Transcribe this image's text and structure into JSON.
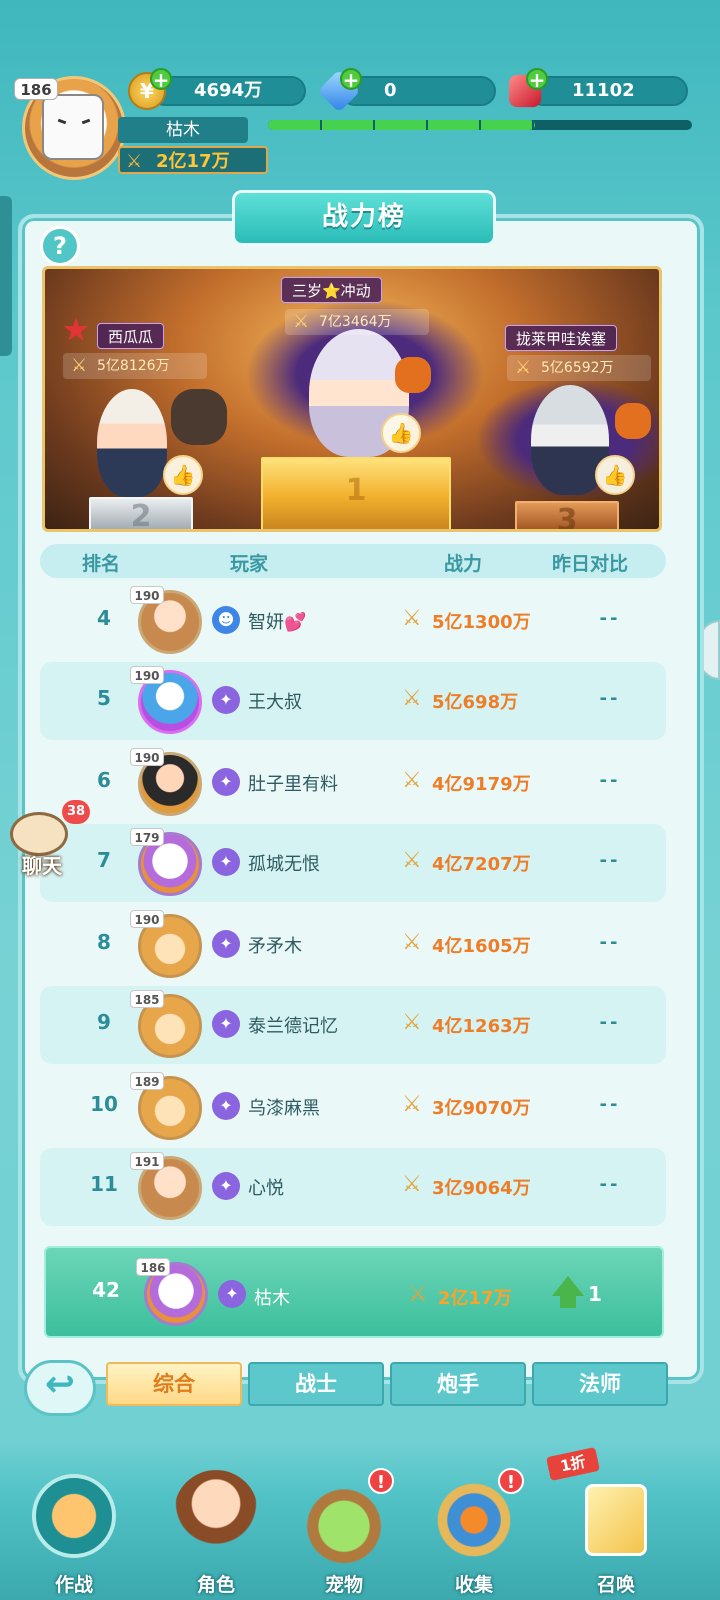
{
  "player": {
    "level": "186",
    "name": "枯木",
    "power": "2亿17万",
    "xp_fraction": 0.63
  },
  "resources": {
    "gold": "4694万",
    "diamond": "0",
    "ruby": "11102"
  },
  "board": {
    "title": "战力榜",
    "help_glyph": "?"
  },
  "podium": {
    "first": {
      "name": "三岁⭐冲动",
      "power": "7亿3464万",
      "place": "1"
    },
    "second": {
      "name": "西瓜瓜",
      "power": "5亿8126万",
      "place": "2"
    },
    "third": {
      "name": "拢莱甲哇诶塞",
      "power": "5亿6592万",
      "place": "3"
    }
  },
  "table": {
    "headers": {
      "rank": "排名",
      "player": "玩家",
      "power": "战力",
      "compare": "昨日对比"
    },
    "rows": [
      {
        "rank": "4",
        "level": "190",
        "name": "智妍💕",
        "power": "5亿1300万",
        "compare": "--"
      },
      {
        "rank": "5",
        "level": "190",
        "name": "王大叔",
        "power": "5亿698万",
        "compare": "--"
      },
      {
        "rank": "6",
        "level": "190",
        "name": "肚子里有料",
        "power": "4亿9179万",
        "compare": "--"
      },
      {
        "rank": "7",
        "level": "179",
        "name": "孤城无恨",
        "power": "4亿7207万",
        "compare": "--"
      },
      {
        "rank": "8",
        "level": "190",
        "name": "矛矛木",
        "power": "4亿1605万",
        "compare": "--"
      },
      {
        "rank": "9",
        "level": "185",
        "name": "泰兰德记忆",
        "power": "4亿1263万",
        "compare": "--"
      },
      {
        "rank": "10",
        "level": "189",
        "name": "乌漆麻黑",
        "power": "3亿9070万",
        "compare": "--"
      },
      {
        "rank": "11",
        "level": "191",
        "name": "心悦",
        "power": "3亿9064万",
        "compare": "--"
      }
    ],
    "me": {
      "rank": "42",
      "level": "186",
      "name": "枯木",
      "power": "2亿17万",
      "change": "1"
    }
  },
  "chat": {
    "label": "聊天",
    "badge": "38"
  },
  "tabs": [
    "综合",
    "战士",
    "炮手",
    "法师"
  ],
  "nav": {
    "battle": "作战",
    "character": "角色",
    "pet": "宠物",
    "collect": "收集",
    "summon": "召唤",
    "discount": "1折",
    "alert": "!"
  },
  "colors": {
    "accent": "#3fb7bd",
    "power_text": "#ee7d27",
    "active_tab": "#ffd987"
  }
}
